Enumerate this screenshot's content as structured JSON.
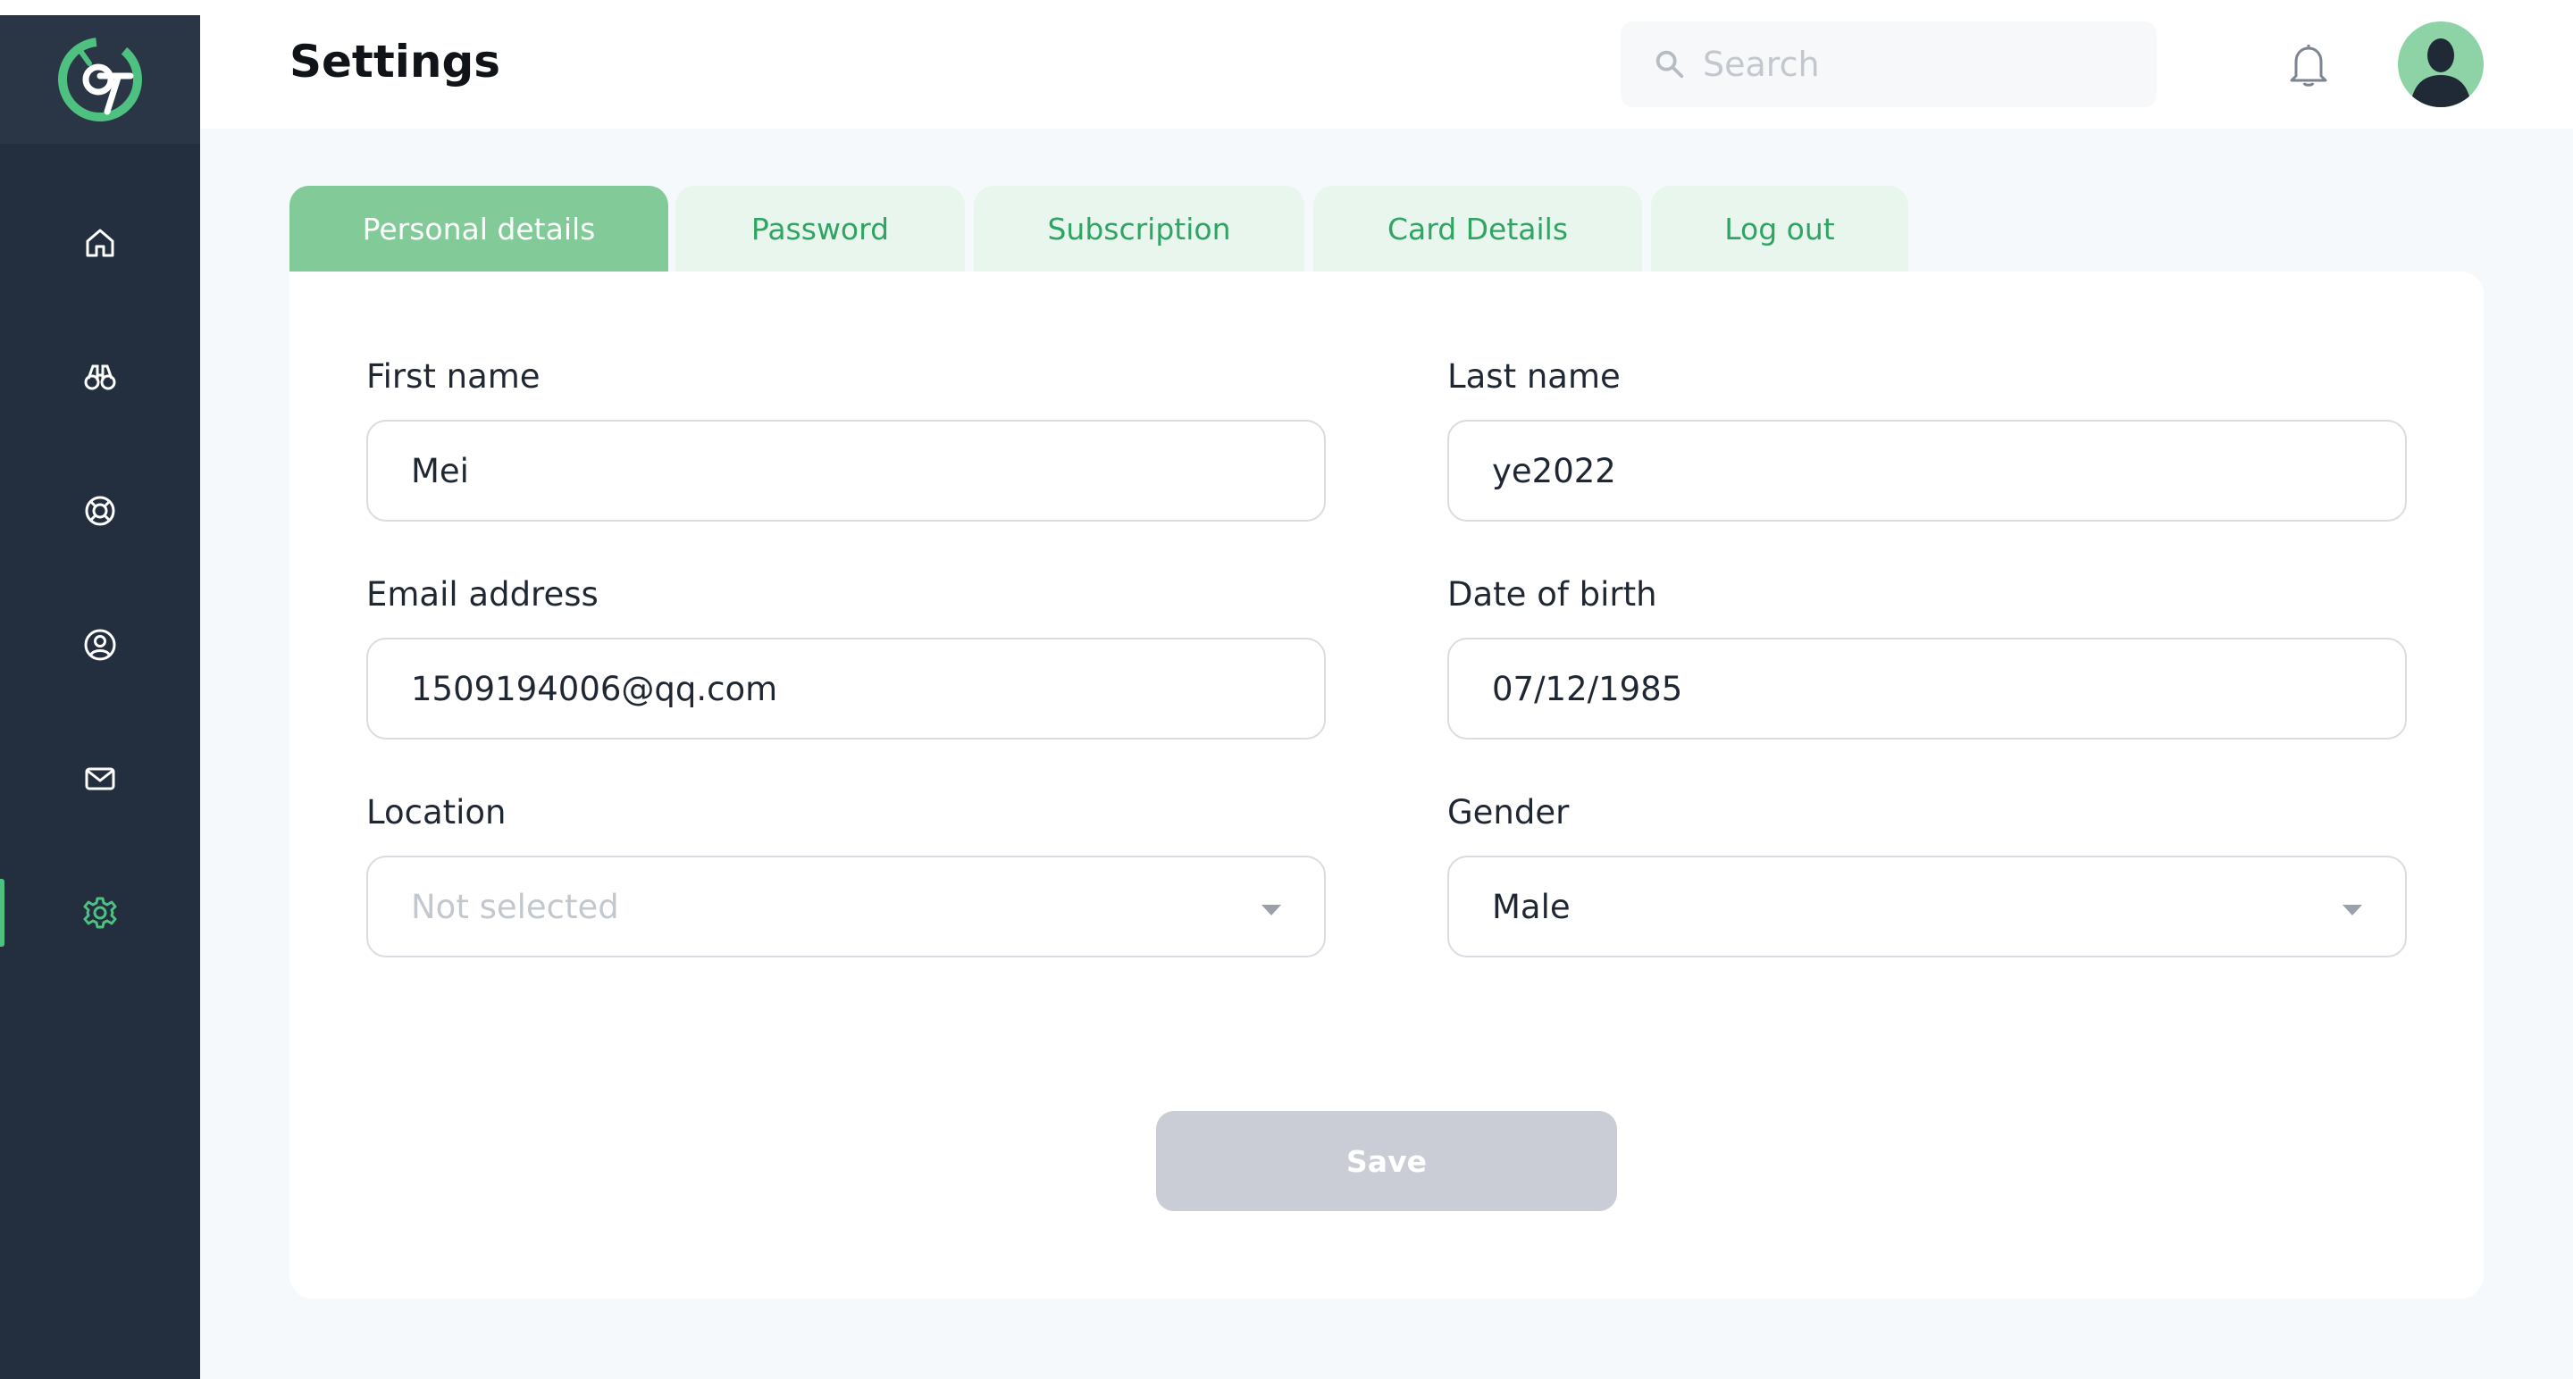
{
  "header": {
    "title": "Settings",
    "search_placeholder": "Search"
  },
  "sidebar": {
    "items": [
      {
        "name": "home",
        "icon": "home-icon"
      },
      {
        "name": "explore",
        "icon": "binoculars-icon"
      },
      {
        "name": "support",
        "icon": "lifebuoy-icon"
      },
      {
        "name": "profile",
        "icon": "user-circle-icon"
      },
      {
        "name": "messages",
        "icon": "mail-icon"
      },
      {
        "name": "settings",
        "icon": "gear-icon",
        "active": true
      }
    ]
  },
  "tabs": [
    {
      "label": "Personal details",
      "active": true
    },
    {
      "label": "Password"
    },
    {
      "label": "Subscription"
    },
    {
      "label": "Card Details"
    },
    {
      "label": "Log out"
    }
  ],
  "form": {
    "first_name": {
      "label": "First name",
      "value": "Mei"
    },
    "last_name": {
      "label": "Last name",
      "value": "ye2022"
    },
    "email": {
      "label": "Email address",
      "value": "1509194006@qq.com"
    },
    "dob": {
      "label": "Date of birth",
      "value": "07/12/1985"
    },
    "location": {
      "label": "Location",
      "placeholder": "Not selected"
    },
    "gender": {
      "label": "Gender",
      "value": "Male"
    },
    "save_label": "Save"
  },
  "colors": {
    "sidebar_bg": "#232f3e",
    "accent": "#4ec07f",
    "tab_active_bg": "#82cb98",
    "tab_bg": "#e9f6ee",
    "save_disabled_bg": "#cbcdd6"
  }
}
